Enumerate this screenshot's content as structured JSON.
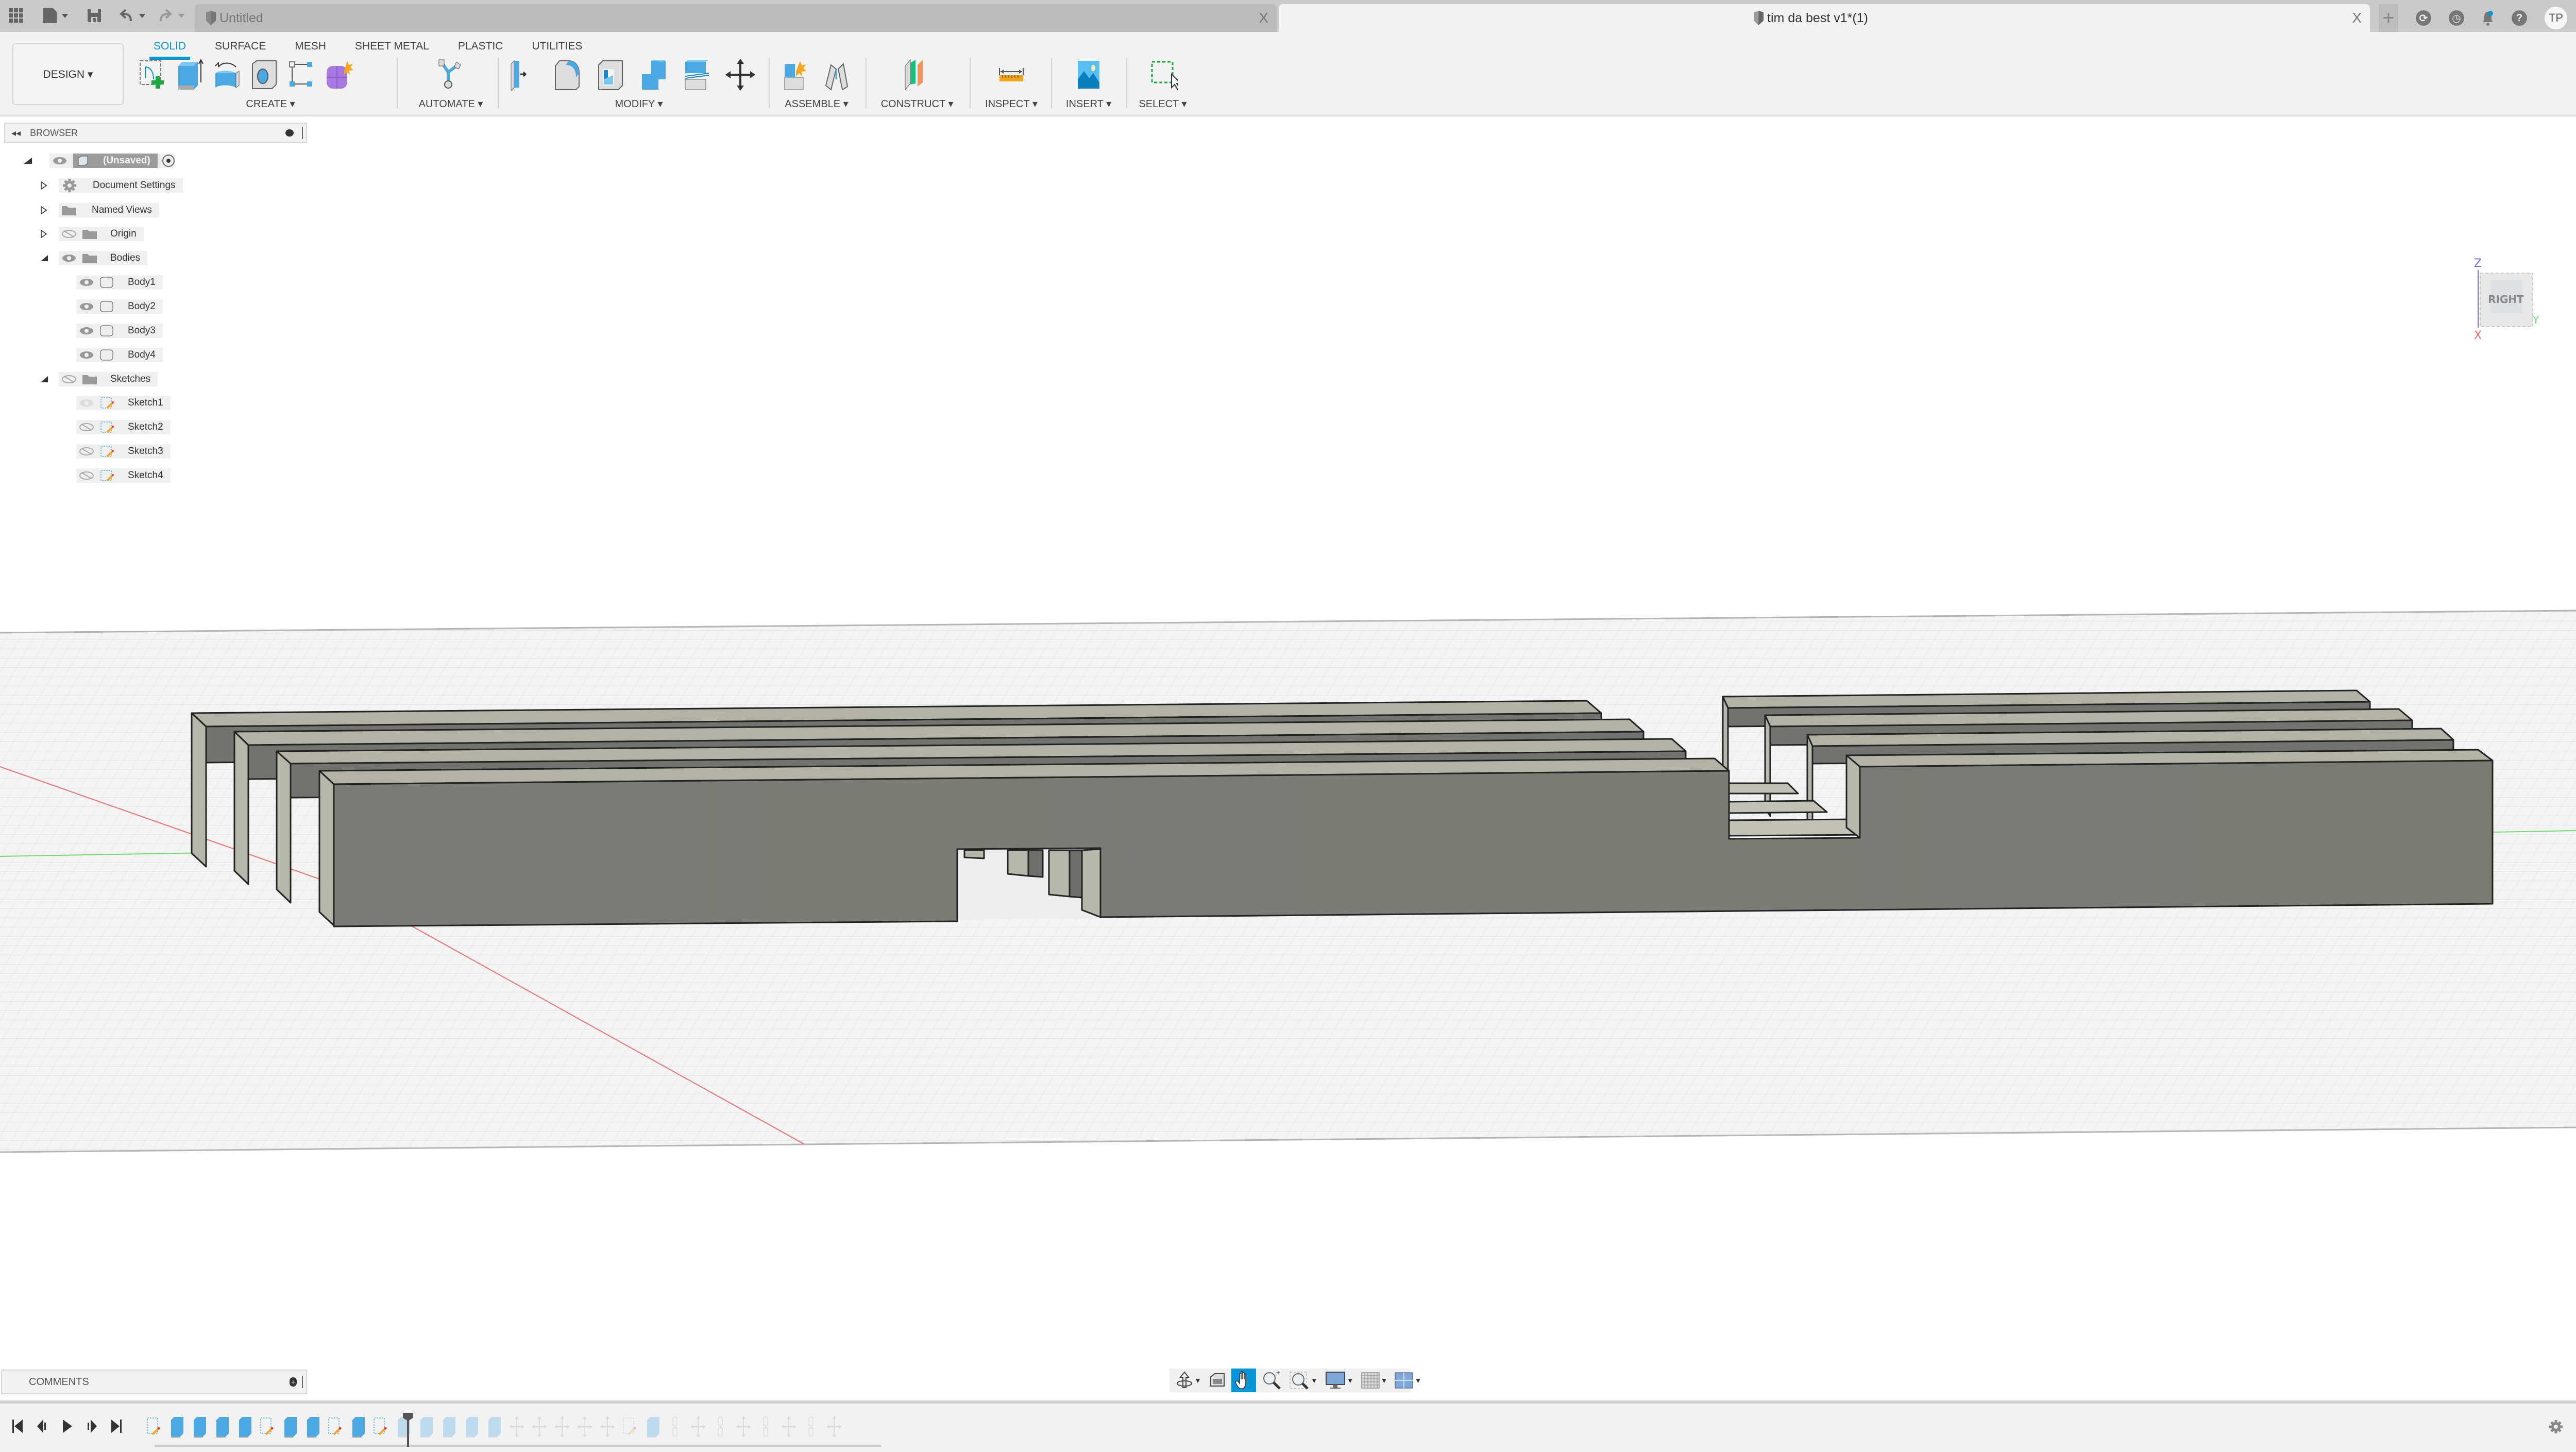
{
  "titlebar": {
    "quick_access": [
      {
        "name": "apps-grid-icon"
      },
      {
        "name": "file-menu-icon"
      },
      {
        "name": "save-icon"
      },
      {
        "name": "undo-icon"
      },
      {
        "name": "redo-icon"
      }
    ],
    "tabs": [
      {
        "label": "Untitled",
        "active": false,
        "close": "X"
      },
      {
        "label": "tim da best v1*(1)",
        "active": true,
        "close": "X"
      }
    ],
    "new_tab": "+",
    "user_initials": "TP"
  },
  "ribbon": {
    "workspace": "DESIGN ▾",
    "tabs": [
      {
        "label": "SOLID",
        "active": true
      },
      {
        "label": "SURFACE",
        "active": false
      },
      {
        "label": "MESH",
        "active": false
      },
      {
        "label": "SHEET METAL",
        "active": false
      },
      {
        "label": "PLASTIC",
        "active": false
      },
      {
        "label": "UTILITIES",
        "active": false
      }
    ],
    "groups": {
      "create": "CREATE ▾",
      "automate": "AUTOMATE ▾",
      "modify": "MODIFY ▾",
      "assemble": "ASSEMBLE ▾",
      "construct": "CONSTRUCT ▾",
      "inspect": "INSPECT ▾",
      "insert": "INSERT ▾",
      "select": "SELECT ▾"
    },
    "colors": {
      "accent": "#0696d7"
    }
  },
  "browser": {
    "title": "BROWSER",
    "root": "(Unsaved)",
    "items": [
      {
        "label": "Document Settings",
        "icon": "gear-icon",
        "expanded": false,
        "visible": null
      },
      {
        "label": "Named Views",
        "icon": "folder-icon",
        "expanded": false,
        "visible": null
      },
      {
        "label": "Origin",
        "icon": "folder-icon",
        "expanded": false,
        "visible": false
      },
      {
        "label": "Bodies",
        "icon": "folder-icon",
        "expanded": true,
        "visible": true,
        "children": [
          {
            "label": "Body1",
            "visible": true
          },
          {
            "label": "Body2",
            "visible": true
          },
          {
            "label": "Body3",
            "visible": true
          },
          {
            "label": "Body4",
            "visible": true
          }
        ]
      },
      {
        "label": "Sketches",
        "icon": "folder-icon",
        "expanded": true,
        "visible": false,
        "children": [
          {
            "label": "Sketch1",
            "visible": "dim"
          },
          {
            "label": "Sketch2",
            "visible": false
          },
          {
            "label": "Sketch3",
            "visible": false
          },
          {
            "label": "Sketch4",
            "visible": false
          }
        ]
      }
    ]
  },
  "viewcube": {
    "face": "RIGHT",
    "axes": {
      "z": "Z",
      "x": "X",
      "y": "Y"
    }
  },
  "comments": {
    "title": "COMMENTS"
  },
  "navbar": {
    "tools": [
      "orbit",
      "look-at",
      "pan",
      "zoom",
      "fit-window",
      "display-settings",
      "grid-snaps",
      "viewports"
    ],
    "active": "pan"
  },
  "timeline": {
    "controls": [
      "go-to-start",
      "step-back",
      "play",
      "step-forward",
      "go-to-end"
    ],
    "features": [
      "sketch",
      "extrude",
      "extrude",
      "extrude",
      "extrude",
      "sketch",
      "extrude",
      "extrude",
      "sketch",
      "extrude",
      "sketch",
      "extrude-suppressed",
      "extrude-suppressed",
      "extrude-suppressed",
      "extrude-suppressed",
      "extrude-suppressed",
      "move-suppressed",
      "move-suppressed",
      "move-suppressed",
      "move-suppressed",
      "move-suppressed",
      "sketch-suppressed",
      "extrude-suppressed",
      "joint-suppressed",
      "move-suppressed",
      "joint-suppressed",
      "move-suppressed",
      "joint-suppressed",
      "move-suppressed",
      "joint-suppressed",
      "move-suppressed"
    ],
    "marker_after_index": 10
  }
}
